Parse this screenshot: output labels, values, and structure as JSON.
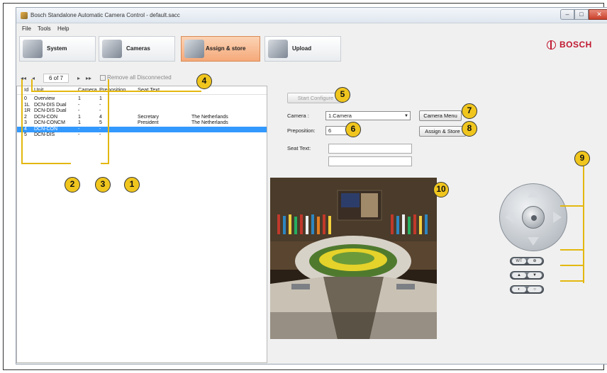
{
  "window": {
    "title": "Bosch Standalone Automatic Camera Control - default.sacc",
    "minimize": "–",
    "maximize": "□",
    "close": "✕"
  },
  "menu": {
    "file": "File",
    "tools": "Tools",
    "help": "Help"
  },
  "brand": {
    "name": "BOSCH",
    "color": "#c01830"
  },
  "steps": [
    {
      "label": "System",
      "icon": "system-icon"
    },
    {
      "label": "Cameras",
      "icon": "camera-icon"
    },
    {
      "label": "Assign & store",
      "icon": "assign-store-icon",
      "active": true
    },
    {
      "label": "Upload",
      "icon": "upload-icon"
    }
  ],
  "navigator": {
    "first": "◂◂",
    "prev": "◂",
    "position": "6 of 7",
    "next": "▸",
    "last": "▸▸",
    "remove_all": "Remove all Disconnected"
  },
  "list": {
    "headers": [
      "Id",
      "Unit",
      "Camera",
      "Preposition",
      "Seat Text",
      ""
    ],
    "rows": [
      {
        "id": "0",
        "unit": "Overview",
        "camera": "1",
        "preposition": "1",
        "seat": "",
        "country": ""
      },
      {
        "id": "1L",
        "unit": "DCN-DIS Dual",
        "camera": "-",
        "preposition": "-",
        "seat": "",
        "country": ""
      },
      {
        "id": "1R",
        "unit": "DCN-DIS Dual",
        "camera": "-",
        "preposition": "-",
        "seat": "",
        "country": ""
      },
      {
        "id": "2",
        "unit": "DCN-CON",
        "camera": "1",
        "preposition": "4",
        "seat": "Secretary",
        "country": "The Netherlands"
      },
      {
        "id": "3",
        "unit": "DCN-CONCM",
        "camera": "1",
        "preposition": "5",
        "seat": "President",
        "country": "The Netherlands"
      },
      {
        "id": "4",
        "unit": "DCN-CON",
        "camera": "-",
        "preposition": "-",
        "seat": "",
        "country": "",
        "selected": true
      },
      {
        "id": "5",
        "unit": "DCN-DIS",
        "camera": "-",
        "preposition": "-",
        "seat": "",
        "country": ""
      }
    ]
  },
  "form": {
    "start_configure": "Start Configure",
    "camera_label": "Camera :",
    "camera_value": "1.Camera",
    "camera_menu": "Camera Menu",
    "preposition_label": "Preposition:",
    "preposition_value": "6",
    "assign_store": "Assign & Store",
    "seat_text_label": "Seat Text:",
    "seat_text_line1": "",
    "seat_text_line2": ""
  },
  "callouts": [
    "1",
    "2",
    "3",
    "4",
    "5",
    "6",
    "7",
    "8",
    "9",
    "10"
  ],
  "ptz": {
    "zoom_pill": [
      "WT",
      "⊕"
    ],
    "focus_pill": [
      "▲",
      "▼"
    ],
    "iris_pill": [
      "◐",
      "○"
    ]
  }
}
